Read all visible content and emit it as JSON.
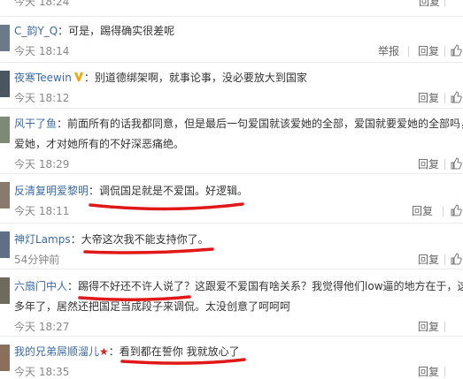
{
  "comments": [
    {
      "time": "今天 18:24",
      "actions": {
        "reply": "回复"
      }
    },
    {
      "user": "C_韵Y_Q",
      "text": "：可是，踢得确实很差呢",
      "time": "今天 18:14",
      "actions": {
        "report": "举报",
        "reply": "回复"
      }
    },
    {
      "user": "夜寒Teewin",
      "text": "：别道德绑架啊，就事论事，没必要放大到国家",
      "time": "今天 18:12",
      "actions": {
        "reply": "回复"
      }
    },
    {
      "user": "风干了鱼",
      "text": "：前面所有的话我都同意，但是最后一句爱国就该爱她的全部，爱国就要爱她的全部吗，",
      "text2": "爱她，才对她所有的不好深恶痛绝。",
      "time": "今天 18:29",
      "actions": {
        "reply": "回复"
      }
    },
    {
      "user": "反清复明爱黎明",
      "text": "：调侃国足就是不爱国。好逻辑。",
      "time": "今天 18:11",
      "actions": {
        "reply": "回复"
      }
    },
    {
      "user": "神灯Lamps",
      "text": "：大帝这次我不能支持你了。",
      "time": "54分钟前",
      "actions": {
        "reply": "回复"
      }
    },
    {
      "user": "六扇门中人",
      "text": "：踢得不好还不许人说了？这跟爱不爱国有啥关系？我觉得他们low逼的地方在于，这",
      "text2": "多年了，居然还把国足当成段子来调侃。太没创意了呵呵呵",
      "time": "今天 18:27",
      "actions": {
        "reply": "回复"
      }
    },
    {
      "user": "我的兄弟屌顺溜儿",
      "text": "：看到都在誓你 我就放心了",
      "time": "今天 18:35",
      "actions": {
        "reply": "回复"
      }
    }
  ],
  "colors": {
    "username": "#3b6aa8",
    "annotation": "#e01818"
  },
  "icons": [
    "vip-v-icon",
    "red-star-icon",
    "thumbs-up-icon"
  ]
}
